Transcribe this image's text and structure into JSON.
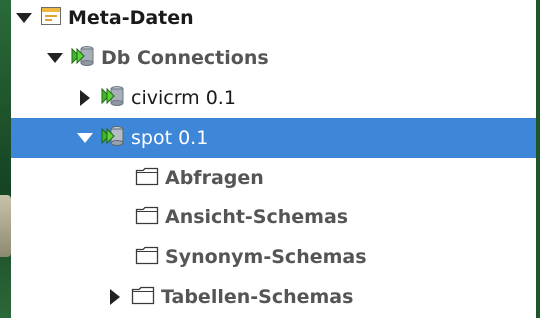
{
  "tree": {
    "root": {
      "label": "Meta-Daten",
      "expanded": true,
      "icon": "metadata-window-icon"
    },
    "db_connections": {
      "label": "Db Connections",
      "expanded": true,
      "icon": "database-connection-icon"
    },
    "connections": [
      {
        "label": "civicrm 0.1",
        "expanded": false,
        "selected": false,
        "icon": "database-connection-icon"
      },
      {
        "label": "spot 0.1",
        "expanded": true,
        "selected": true,
        "icon": "database-connection-icon"
      }
    ],
    "folders": [
      {
        "label": "Abfragen",
        "has_children": false,
        "icon": "folder-icon"
      },
      {
        "label": "Ansicht-Schemas",
        "has_children": false,
        "icon": "folder-icon"
      },
      {
        "label": "Synonym-Schemas",
        "has_children": false,
        "icon": "folder-icon"
      },
      {
        "label": "Tabellen-Schemas",
        "has_children": true,
        "icon": "folder-icon"
      }
    ],
    "colors": {
      "selection": "#3d86d8",
      "folder_text": "#555555",
      "desktop_green": "#1f5a2c"
    }
  }
}
